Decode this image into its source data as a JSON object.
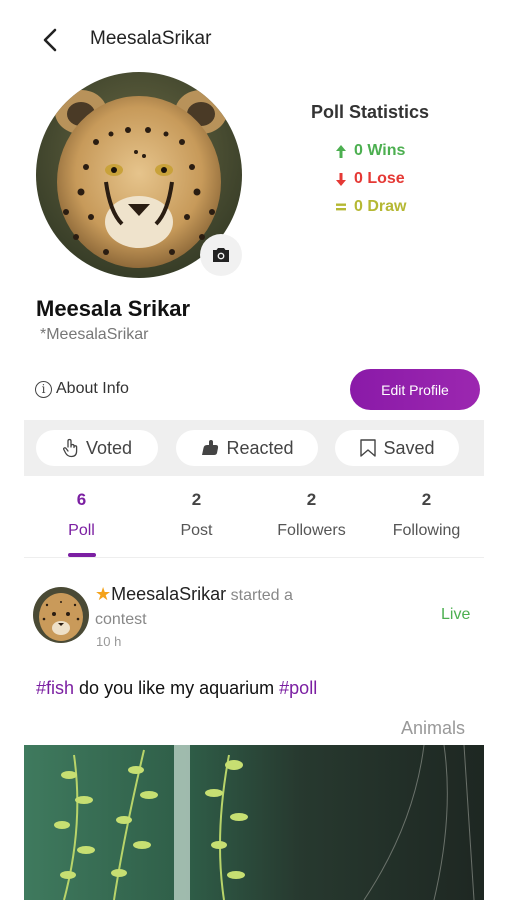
{
  "header": {
    "title": "MeesalaSrikar"
  },
  "profile": {
    "name": "Meesala Srikar",
    "handle": "*MeesalaSrikar"
  },
  "poll_statistics": {
    "title": "Poll Statistics",
    "wins": "0 Wins",
    "lose": "0 Lose",
    "draw": "0 Draw"
  },
  "actions": {
    "about": "About Info",
    "edit_profile": "Edit Profile"
  },
  "filters": {
    "voted": "Voted",
    "reacted": "Reacted",
    "saved": "Saved"
  },
  "tabs": [
    {
      "count": "6",
      "label": "Poll"
    },
    {
      "count": "2",
      "label": "Post"
    },
    {
      "count": "2",
      "label": "Followers"
    },
    {
      "count": "2",
      "label": "Following"
    }
  ],
  "post": {
    "user": "MeesalaSrikar",
    "action": "started a contest",
    "time": "10 h",
    "status": "Live",
    "tag1": "#fish",
    "text": "do you like my aquarium",
    "tag2": "#poll",
    "category": "Animals"
  },
  "colors": {
    "accent": "#7b1fa2",
    "win": "#4caf50",
    "lose": "#e53935",
    "draw": "#b5b833"
  },
  "icons": [
    "back-arrow-icon",
    "camera-icon",
    "arrow-up-icon",
    "arrow-down-icon",
    "equals-icon",
    "info-icon",
    "hand-pointer-icon",
    "reaction-icon",
    "bookmark-icon",
    "star-icon"
  ]
}
